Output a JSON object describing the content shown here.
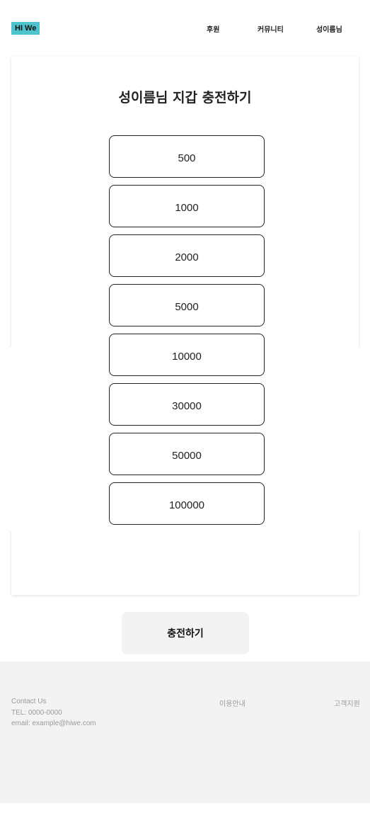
{
  "header": {
    "logo": "HI We",
    "nav": [
      "후원",
      "커뮤니티",
      "성이름님"
    ]
  },
  "main": {
    "title": "성이름님 지갑 충전하기",
    "amounts": [
      "500",
      "1000",
      "2000",
      "5000",
      "10000",
      "30000",
      "50000",
      "100000"
    ],
    "charge_button": "충전하기"
  },
  "footer": {
    "contact_title": "Contact Us",
    "tel": "TEL: 0000-0000",
    "email": "email: example@hiwe.com",
    "guide": "이용안내",
    "support": "고객지원"
  },
  "colors": {
    "logo_bg": "#4dc3cb",
    "footer_bg": "#f3f3f3",
    "button_bg": "#f3f3f3"
  }
}
